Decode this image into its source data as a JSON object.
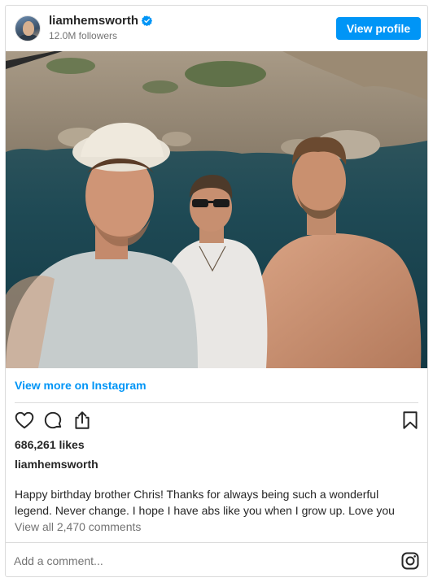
{
  "header": {
    "username": "liamhemsworth",
    "followers": "12.0M followers",
    "view_profile_label": "View profile"
  },
  "post": {
    "image_icon": "group-selfie-photo",
    "view_more_label": "View more on Instagram",
    "likes": "686,261 likes",
    "caption_username": "liamhemsworth",
    "caption_line1": "Happy birthday brother Chris! Thanks for always being such a wonderful",
    "caption_line2": "legend. Never change. I hope I have abs like you when I grow up. Love you",
    "view_comments": "View all 2,470 comments",
    "comment_placeholder": "Add a comment..."
  },
  "icons": {
    "like": "heart-icon",
    "comment": "comment-icon",
    "share": "share-icon",
    "save": "bookmark-icon",
    "instagram": "instagram-icon",
    "verified": "verified-badge-icon"
  },
  "colors": {
    "accent": "#0095f6",
    "text": "#262626",
    "muted": "#737373",
    "border": "#dbdbdb"
  }
}
